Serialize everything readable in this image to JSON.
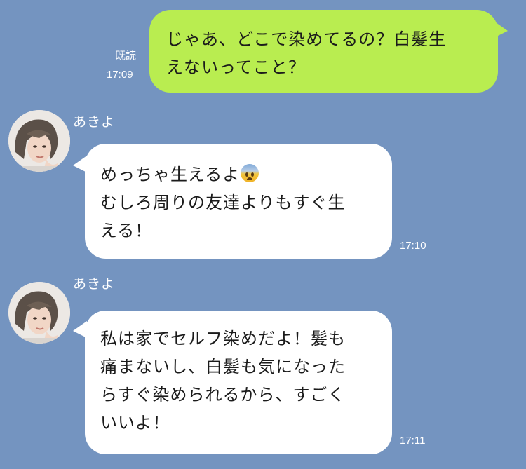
{
  "messages": [
    {
      "direction": "outgoing",
      "lines": [
        "じゃあ、どこで染めてるの？白髪生",
        "えないってこと？"
      ],
      "read_label": "既読",
      "time": "17:09"
    },
    {
      "direction": "incoming",
      "sender": "あきよ",
      "lines": [
        "めっちゃ生えるよ",
        "むしろ周りの友達よりもすぐ生",
        "える！"
      ],
      "emoji": "anxious-face-emoji",
      "time": "17:10"
    },
    {
      "direction": "incoming",
      "sender": "あきよ",
      "lines": [
        "私は家でセルフ染めだよ！髪も",
        "痛まないし、白髪も気になった",
        "らすぐ染められるから、すごく",
        "いいよ！"
      ],
      "time": "17:11"
    }
  ],
  "colors": {
    "background": "#7494c0",
    "outgoing_bubble": "#b9ed50",
    "incoming_bubble": "#ffffff",
    "meta_text": "#ffffff"
  }
}
